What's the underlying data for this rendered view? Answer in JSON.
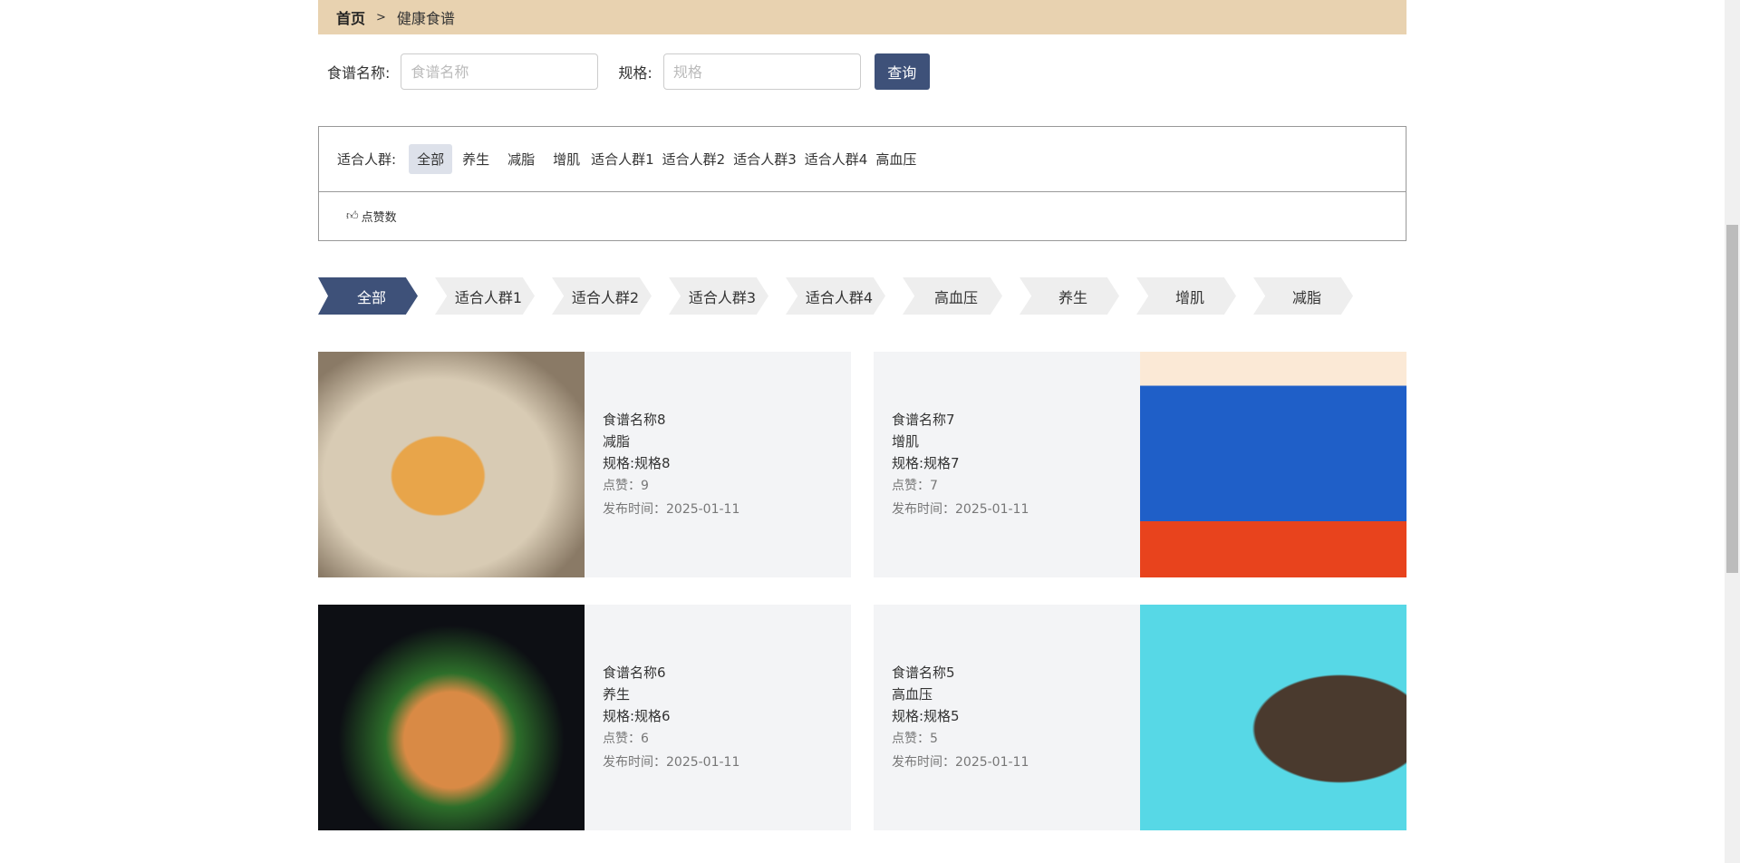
{
  "breadcrumb": {
    "home": "首页",
    "sep": ">",
    "current": "健康食谱"
  },
  "search": {
    "name_label": "食谱名称:",
    "name_placeholder": "食谱名称",
    "spec_label": "规格:",
    "spec_placeholder": "规格",
    "button": "查询"
  },
  "filter": {
    "label": "适合人群:",
    "options": [
      "全部",
      "养生",
      "减脂",
      "增肌",
      "适合人群1",
      "适合人群2",
      "适合人群3",
      "适合人群4",
      "高血压"
    ],
    "selected": "全部",
    "sort_label": "点赞数"
  },
  "tabs": [
    "全部",
    "适合人群1",
    "适合人群2",
    "适合人群3",
    "适合人群4",
    "高血压",
    "养生",
    "增肌",
    "减脂"
  ],
  "cards": [
    {
      "name": "食谱名称8",
      "group": "减脂",
      "spec": "规格:规格8",
      "likes": "点赞：9",
      "date": "发布时间：2025-01-11"
    },
    {
      "name": "食谱名称7",
      "group": "增肌",
      "spec": "规格:规格7",
      "likes": "点赞：7",
      "date": "发布时间：2025-01-11"
    },
    {
      "name": "食谱名称6",
      "group": "养生",
      "spec": "规格:规格6",
      "likes": "点赞：6",
      "date": "发布时间：2025-01-11"
    },
    {
      "name": "食谱名称5",
      "group": "高血压",
      "spec": "规格:规格5",
      "likes": "点赞：5",
      "date": "发布时间：2025-01-11"
    }
  ]
}
